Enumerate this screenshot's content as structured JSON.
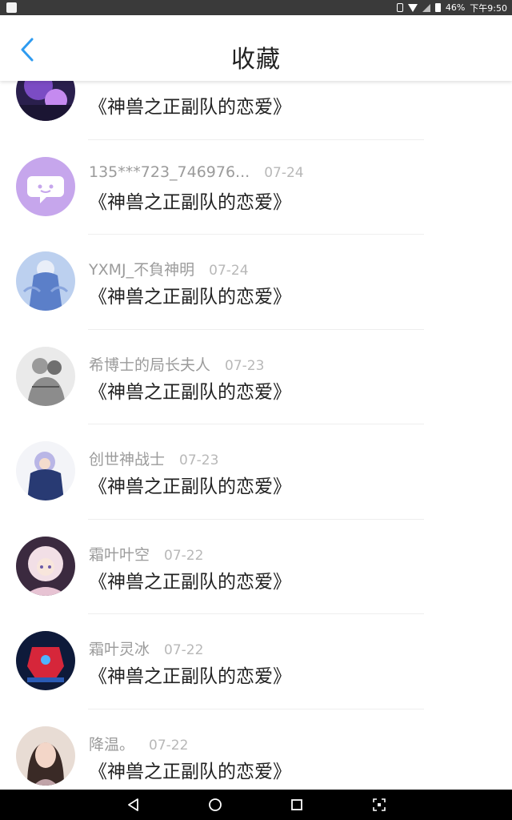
{
  "status_bar": {
    "battery": "46%",
    "time": "下午9:50",
    "icons": [
      "app-icon",
      "vibrate-icon",
      "wifi-icon",
      "signal-icon",
      "battery-icon"
    ]
  },
  "header": {
    "title": "收藏",
    "back_icon": "chevron-left-icon",
    "accent": "#2e9bf0"
  },
  "items": [
    {
      "username": "",
      "date": "",
      "title": "《神兽之正副队的恋爱》",
      "avatar": "avatar-purple-anime"
    },
    {
      "username": "135***723_746976...",
      "date": "07-24",
      "title": "《神兽之正副队的恋爱》",
      "avatar": "avatar-default-chat"
    },
    {
      "username": "YXMJ_不負神明",
      "date": "07-24",
      "title": "《神兽之正副队的恋爱》",
      "avatar": "avatar-blue-anime"
    },
    {
      "username": "希博士的局长夫人",
      "date": "07-23",
      "title": "《神兽之正副队的恋爱》",
      "avatar": "avatar-sketch"
    },
    {
      "username": "创世神战士",
      "date": "07-23",
      "title": "《神兽之正副队的恋爱》",
      "avatar": "avatar-navy-anime"
    },
    {
      "username": "霜叶叶空",
      "date": "07-22",
      "title": "《神兽之正副队的恋爱》",
      "avatar": "avatar-pink-anime"
    },
    {
      "username": "霜叶灵冰",
      "date": "07-22",
      "title": "《神兽之正副队的恋爱》",
      "avatar": "avatar-red-robot"
    },
    {
      "username": "降温。",
      "date": "07-22",
      "title": "《神兽之正副队的恋爱》",
      "avatar": "avatar-photo"
    }
  ],
  "nav_bar": {
    "icons": [
      "nav-back-icon",
      "nav-home-icon",
      "nav-recents-icon",
      "screenshot-icon"
    ]
  }
}
